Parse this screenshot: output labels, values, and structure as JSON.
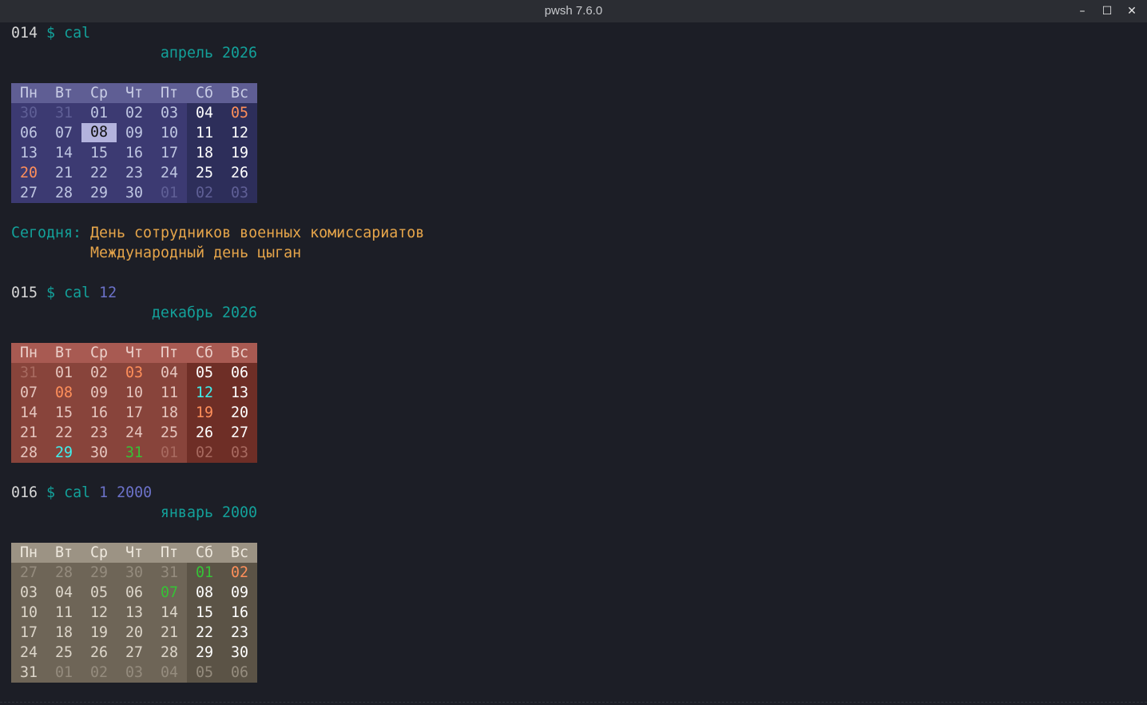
{
  "window": {
    "title": "pwsh 7.6.0",
    "controls": {
      "minimize": "–",
      "maximize": "☐",
      "close": "✕"
    }
  },
  "weekdays": [
    "Пн",
    "Вт",
    "Ср",
    "Чт",
    "Пт",
    "Сб",
    "Вс"
  ],
  "sessions": [
    {
      "prompt_no": "014",
      "dollar": "$",
      "command": "cal",
      "args": "",
      "month_title": "апрель 2026",
      "colors": {
        "header": "#5f5e94",
        "weekday": "#3c3a72",
        "weekend": "#2d2e5a",
        "text": "#bfc6e2",
        "other": "#5f5f96",
        "weekend_text": "#ffffff",
        "header_text": "#c9cde6"
      },
      "weeks": [
        [
          {
            "d": "30",
            "s": "other"
          },
          {
            "d": "31",
            "s": "other"
          },
          {
            "d": "01"
          },
          {
            "d": "02"
          },
          {
            "d": "03"
          },
          {
            "d": "04"
          },
          {
            "d": "05",
            "s": "holiday"
          }
        ],
        [
          {
            "d": "06"
          },
          {
            "d": "07"
          },
          {
            "d": "08",
            "s": "today"
          },
          {
            "d": "09"
          },
          {
            "d": "10"
          },
          {
            "d": "11"
          },
          {
            "d": "12"
          }
        ],
        [
          {
            "d": "13"
          },
          {
            "d": "14"
          },
          {
            "d": "15"
          },
          {
            "d": "16"
          },
          {
            "d": "17"
          },
          {
            "d": "18"
          },
          {
            "d": "19"
          }
        ],
        [
          {
            "d": "20",
            "s": "holiday"
          },
          {
            "d": "21"
          },
          {
            "d": "22"
          },
          {
            "d": "23"
          },
          {
            "d": "24"
          },
          {
            "d": "25"
          },
          {
            "d": "26"
          }
        ],
        [
          {
            "d": "27"
          },
          {
            "d": "28"
          },
          {
            "d": "29"
          },
          {
            "d": "30"
          },
          {
            "d": "01",
            "s": "other"
          },
          {
            "d": "02",
            "s": "other"
          },
          {
            "d": "03",
            "s": "other"
          }
        ]
      ],
      "today": {
        "label": "Сегодня:",
        "events": [
          "День сотрудников военных комиссариатов",
          "Международный день цыган"
        ]
      }
    },
    {
      "prompt_no": "015",
      "dollar": "$",
      "command": "cal",
      "args": "12",
      "month_title": "декабрь 2026",
      "colors": {
        "header": "#a85a52",
        "weekday": "#88443b",
        "weekend": "#6e2e26",
        "text": "#e6c6bf",
        "other": "#a86a60",
        "weekend_text": "#ffffff",
        "header_text": "#ecd0ca"
      },
      "weeks": [
        [
          {
            "d": "31",
            "s": "other"
          },
          {
            "d": "01"
          },
          {
            "d": "02"
          },
          {
            "d": "03",
            "s": "holiday"
          },
          {
            "d": "04"
          },
          {
            "d": "05"
          },
          {
            "d": "06"
          }
        ],
        [
          {
            "d": "07"
          },
          {
            "d": "08",
            "s": "holiday"
          },
          {
            "d": "09"
          },
          {
            "d": "10"
          },
          {
            "d": "11"
          },
          {
            "d": "12",
            "s": "cyan"
          },
          {
            "d": "13"
          }
        ],
        [
          {
            "d": "14"
          },
          {
            "d": "15"
          },
          {
            "d": "16"
          },
          {
            "d": "17"
          },
          {
            "d": "18"
          },
          {
            "d": "19",
            "s": "holiday"
          },
          {
            "d": "20"
          }
        ],
        [
          {
            "d": "21"
          },
          {
            "d": "22"
          },
          {
            "d": "23"
          },
          {
            "d": "24"
          },
          {
            "d": "25"
          },
          {
            "d": "26"
          },
          {
            "d": "27"
          }
        ],
        [
          {
            "d": "28"
          },
          {
            "d": "29",
            "s": "cyan"
          },
          {
            "d": "30"
          },
          {
            "d": "31",
            "s": "green"
          },
          {
            "d": "01",
            "s": "other"
          },
          {
            "d": "02",
            "s": "other"
          },
          {
            "d": "03",
            "s": "other"
          }
        ]
      ]
    },
    {
      "prompt_no": "016",
      "dollar": "$",
      "command": "cal",
      "args": "1 2000",
      "month_title": "январь 2000",
      "colors": {
        "header": "#9c9384",
        "weekday": "#6e6557",
        "weekend": "#5b5346",
        "text": "#ddd6ca",
        "other": "#958c7e",
        "weekend_text": "#ffffff",
        "header_text": "#efe9de"
      },
      "weeks": [
        [
          {
            "d": "27",
            "s": "other"
          },
          {
            "d": "28",
            "s": "other"
          },
          {
            "d": "29",
            "s": "other"
          },
          {
            "d": "30",
            "s": "other"
          },
          {
            "d": "31",
            "s": "other"
          },
          {
            "d": "01",
            "s": "green"
          },
          {
            "d": "02",
            "s": "holiday"
          }
        ],
        [
          {
            "d": "03"
          },
          {
            "d": "04"
          },
          {
            "d": "05"
          },
          {
            "d": "06"
          },
          {
            "d": "07",
            "s": "green"
          },
          {
            "d": "08"
          },
          {
            "d": "09"
          }
        ],
        [
          {
            "d": "10"
          },
          {
            "d": "11"
          },
          {
            "d": "12"
          },
          {
            "d": "13"
          },
          {
            "d": "14"
          },
          {
            "d": "15"
          },
          {
            "d": "16"
          }
        ],
        [
          {
            "d": "17"
          },
          {
            "d": "18"
          },
          {
            "d": "19"
          },
          {
            "d": "20"
          },
          {
            "d": "21"
          },
          {
            "d": "22"
          },
          {
            "d": "23"
          }
        ],
        [
          {
            "d": "24"
          },
          {
            "d": "25"
          },
          {
            "d": "26"
          },
          {
            "d": "27"
          },
          {
            "d": "28"
          },
          {
            "d": "29"
          },
          {
            "d": "30"
          }
        ],
        [
          {
            "d": "31"
          },
          {
            "d": "01",
            "s": "other"
          },
          {
            "d": "02",
            "s": "other"
          },
          {
            "d": "03",
            "s": "other"
          },
          {
            "d": "04",
            "s": "other"
          },
          {
            "d": "05",
            "s": "other"
          },
          {
            "d": "06",
            "s": "other"
          }
        ]
      ]
    }
  ],
  "accents": {
    "holiday": "#ff8f5a",
    "cyan": "#3ff0ee",
    "green": "#36c236",
    "today_bg": "#b3b3dd",
    "today_fg": "#111111"
  }
}
